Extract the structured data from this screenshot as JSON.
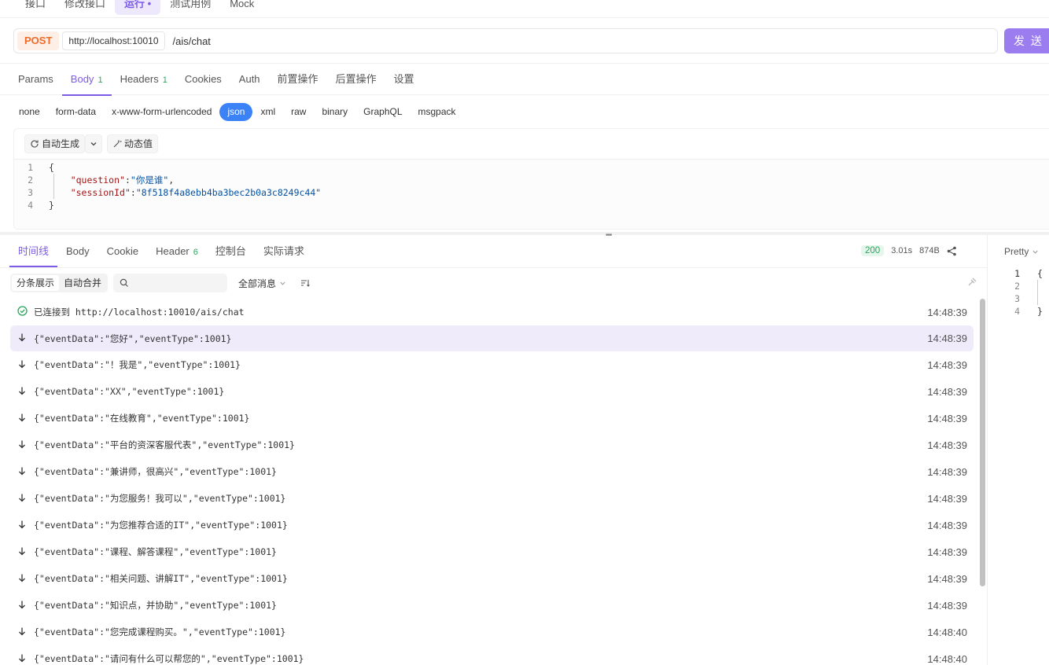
{
  "top_tabs": [
    {
      "label": "接口"
    },
    {
      "label": "修改接口"
    },
    {
      "label": "运行 •"
    },
    {
      "label": "测试用例"
    },
    {
      "label": "Mock"
    }
  ],
  "request": {
    "method": "POST",
    "base_url": "http://localhost:10010",
    "path": "/ais/chat",
    "send_label": "发 送"
  },
  "req_tabs": [
    {
      "label": "Params",
      "badge": ""
    },
    {
      "label": "Body",
      "badge": "1"
    },
    {
      "label": "Headers",
      "badge": "1"
    },
    {
      "label": "Cookies",
      "badge": ""
    },
    {
      "label": "Auth",
      "badge": ""
    },
    {
      "label": "前置操作",
      "badge": ""
    },
    {
      "label": "后置操作",
      "badge": ""
    },
    {
      "label": "设置",
      "badge": ""
    }
  ],
  "body_types": [
    "none",
    "form-data",
    "x-www-form-urlencoded",
    "json",
    "xml",
    "raw",
    "binary",
    "GraphQL",
    "msgpack"
  ],
  "editor": {
    "auto_gen": "自动生成",
    "dynamic_value": "动态值",
    "line_numbers": [
      "1",
      "2",
      "3",
      "4"
    ],
    "open_brace": "{",
    "close_brace": "}",
    "q_key": "\"question\"",
    "q_val": "\"你是谁\"",
    "s_key": "\"sessionId\"",
    "s_val": "\"8f518f4a8ebb4ba3bec2b0a3c8249c44\""
  },
  "resp_tabs": [
    {
      "label": "时间线",
      "badge": ""
    },
    {
      "label": "Body",
      "badge": ""
    },
    {
      "label": "Cookie",
      "badge": ""
    },
    {
      "label": "Header",
      "badge": "6"
    },
    {
      "label": "控制台",
      "badge": ""
    },
    {
      "label": "实际请求",
      "badge": ""
    }
  ],
  "response_meta": {
    "status": "200",
    "time": "3.01s",
    "size": "874B"
  },
  "filter": {
    "split_view": "分条展示",
    "auto_merge": "自动合并",
    "all_messages": "全部消息"
  },
  "timeline": [
    {
      "icon": "check-circle-icon",
      "text": "已连接到 http://localhost:10010/ais/chat",
      "time": "14:48:39"
    },
    {
      "icon": "arrow-down-icon",
      "text": "{\"eventData\":\"您好\",\"eventType\":1001}",
      "time": "14:48:39"
    },
    {
      "icon": "arrow-down-icon",
      "text": "{\"eventData\":\"！我是\",\"eventType\":1001}",
      "time": "14:48:39"
    },
    {
      "icon": "arrow-down-icon",
      "text": "{\"eventData\":\"XX\",\"eventType\":1001}",
      "time": "14:48:39"
    },
    {
      "icon": "arrow-down-icon",
      "text": "{\"eventData\":\"在线教育\",\"eventType\":1001}",
      "time": "14:48:39"
    },
    {
      "icon": "arrow-down-icon",
      "text": "{\"eventData\":\"平台的资深客服代表\",\"eventType\":1001}",
      "time": "14:48:39"
    },
    {
      "icon": "arrow-down-icon",
      "text": "{\"eventData\":\"兼讲师，很高兴\",\"eventType\":1001}",
      "time": "14:48:39"
    },
    {
      "icon": "arrow-down-icon",
      "text": "{\"eventData\":\"为您服务！我可以\",\"eventType\":1001}",
      "time": "14:48:39"
    },
    {
      "icon": "arrow-down-icon",
      "text": "{\"eventData\":\"为您推荐合适的IT\",\"eventType\":1001}",
      "time": "14:48:39"
    },
    {
      "icon": "arrow-down-icon",
      "text": "{\"eventData\":\"课程、解答课程\",\"eventType\":1001}",
      "time": "14:48:39"
    },
    {
      "icon": "arrow-down-icon",
      "text": "{\"eventData\":\"相关问题、讲解IT\",\"eventType\":1001}",
      "time": "14:48:39"
    },
    {
      "icon": "arrow-down-icon",
      "text": "{\"eventData\":\"知识点，并协助\",\"eventType\":1001}",
      "time": "14:48:39"
    },
    {
      "icon": "arrow-down-icon",
      "text": "{\"eventData\":\"您完成课程购买。\",\"eventType\":1001}",
      "time": "14:48:40"
    },
    {
      "icon": "arrow-down-icon",
      "text": "{\"eventData\":\"请问有什么可以帮您的\",\"eventType\":1001}",
      "time": "14:48:40"
    }
  ],
  "right_pane": {
    "format_label": "Pretty",
    "line_numbers": [
      "1",
      "2",
      "3",
      "4"
    ],
    "open_brace": "{",
    "close_brace": "}"
  }
}
